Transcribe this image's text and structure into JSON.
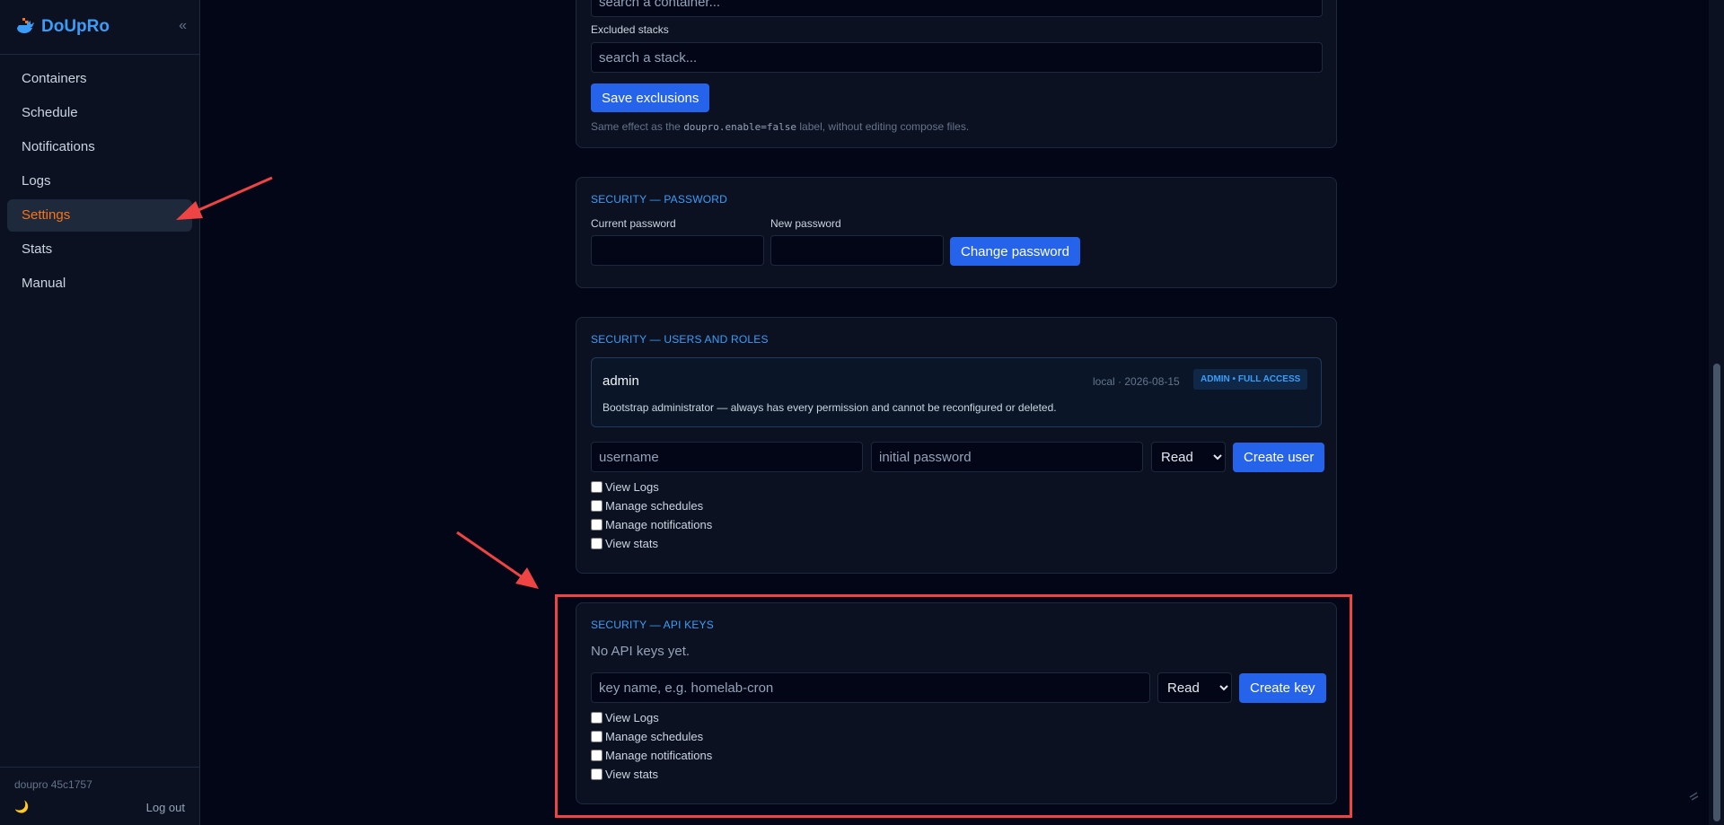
{
  "app": {
    "name": "DoUpRo",
    "version": "doupro 45c1757",
    "logout_label": "Log out",
    "collapse_glyph": "«",
    "theme_glyph": "🌙"
  },
  "nav": [
    {
      "label": "Containers"
    },
    {
      "label": "Schedule"
    },
    {
      "label": "Notifications"
    },
    {
      "label": "Logs"
    },
    {
      "label": "Settings",
      "active": true
    },
    {
      "label": "Stats"
    },
    {
      "label": "Manual"
    }
  ],
  "exclusions": {
    "containers_placeholder": "search a container...",
    "stacks_label": "Excluded stacks",
    "stacks_placeholder": "search a stack...",
    "save_label": "Save exclusions",
    "hint_before": "Same effect as the",
    "hint_code": "doupro.enable=false",
    "hint_after": "label, without editing compose files."
  },
  "password": {
    "title": "SECURITY — PASSWORD",
    "current_label": "Current password",
    "new_label": "New password",
    "change_label": "Change password"
  },
  "users": {
    "title": "SECURITY — USERS AND ROLES",
    "admin_name": "admin",
    "admin_meta": "local · 2026-08-15",
    "admin_badge": "ADMIN • FULL ACCESS",
    "admin_desc": "Bootstrap administrator — always has every permission and cannot be reconfigured or deleted.",
    "username_placeholder": "username",
    "password_placeholder": "initial password",
    "role_value": "Read",
    "create_label": "Create user",
    "permissions": [
      "View Logs",
      "Manage schedules",
      "Manage notifications",
      "View stats"
    ]
  },
  "apikeys": {
    "title": "SECURITY — API KEYS",
    "empty": "No API keys yet.",
    "name_placeholder": "key name, e.g. homelab-cron",
    "role_value": "Read",
    "create_label": "Create key",
    "permissions": [
      "View Logs",
      "Manage schedules",
      "Manage notifications",
      "View stats"
    ]
  },
  "colors": {
    "accent": "#3b9df8",
    "active_nav": "#f97316",
    "primary_button": "#2563eb",
    "highlight": "#ef4444",
    "annotation_arrow": "#ef4444"
  }
}
